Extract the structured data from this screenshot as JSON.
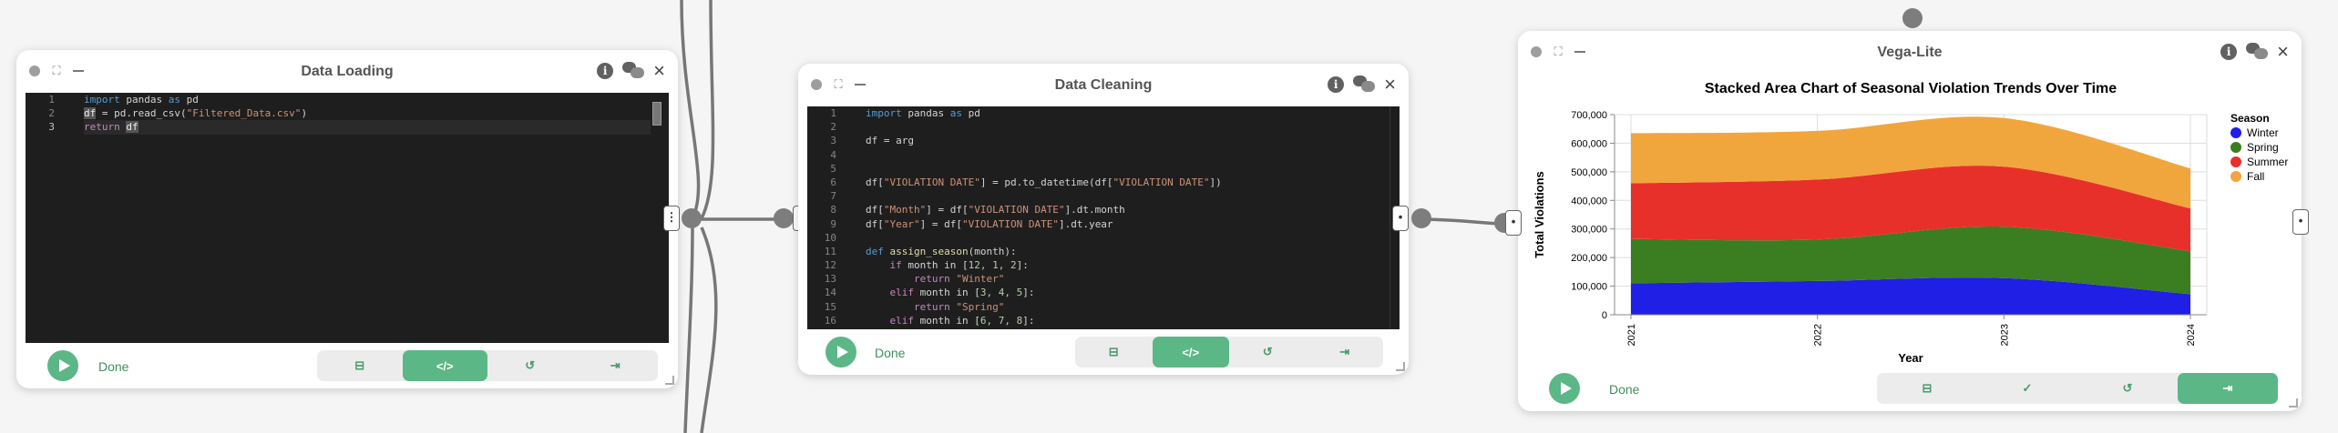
{
  "icons": {
    "code": "</>"
  },
  "nodes": [
    {
      "title": "Data Loading",
      "status": "Done",
      "lines": [
        "1",
        "2",
        "3"
      ],
      "tok": {
        "import": "import",
        "pandas": "pandas",
        "as": "as",
        "pd": "pd",
        "df": "df",
        "assign_read": "= pd.read_csv(",
        "csv": "\"Filtered_Data.csv\"",
        "close": ")",
        "return": "return"
      }
    },
    {
      "title": "Data Cleaning",
      "status": "Done",
      "line_count": 16,
      "tok": {
        "import": "import",
        "pandas": "pandas",
        "as": "as",
        "pd": "pd"
      },
      "code": {
        "l3": "df = arg",
        "l6a": "df[",
        "vd": "\"VIOLATION DATE\"",
        "l6b": "] = pd.to_datetime(df[",
        "l6c": "])",
        "l8a": "df[",
        "month": "\"Month\"",
        "year": "\"Year\"",
        "l8b": "] = df[",
        "l8c": "].dt.month",
        "l9c": "].dt.year",
        "def": "def",
        "fname": "assign_season",
        "fargs": "(month):",
        "ind4": "    ",
        "ind8": "        ",
        "if": "if",
        "elif": "elif",
        "return": "return",
        "cond1a": " month in [",
        "cond1b": "]:",
        "v1": "12, 1, 2",
        "v2": "3, 4, 5",
        "v3": "6, 7, 8",
        "winter": "\"Winter\"",
        "spring": "\"Spring\""
      }
    },
    {
      "title": "Vega-Lite",
      "status": "Done"
    }
  ],
  "chart_data": {
    "type": "area",
    "stacked": true,
    "title": "Stacked Area Chart of Seasonal Violation Trends Over Time",
    "xlabel": "Year",
    "ylabel": "Total Violations",
    "x": [
      "2021",
      "2022",
      "2023",
      "2024"
    ],
    "ylim": [
      0,
      700000
    ],
    "yticks": [
      "0",
      "100,000",
      "200,000",
      "300,000",
      "400,000",
      "500,000",
      "600,000",
      "700,000"
    ],
    "legend_title": "Season",
    "legend_position": "right",
    "series": [
      {
        "name": "Winter",
        "color": "#1f1fe6",
        "values": [
          110000,
          118000,
          128000,
          72000
        ]
      },
      {
        "name": "Spring",
        "color": "#3b7d21",
        "values": [
          155000,
          145000,
          180000,
          150000
        ]
      },
      {
        "name": "Summer",
        "color": "#e8302a",
        "values": [
          195000,
          210000,
          210000,
          150000
        ]
      },
      {
        "name": "Fall",
        "color": "#f0a63c",
        "values": [
          175000,
          170000,
          170000,
          140000
        ]
      }
    ],
    "grid": true
  }
}
